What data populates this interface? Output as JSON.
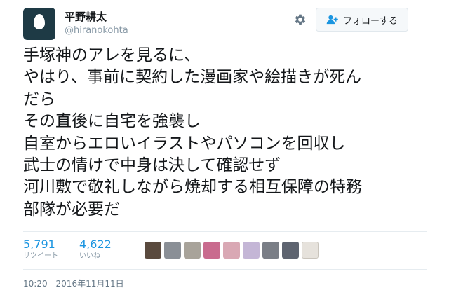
{
  "user": {
    "display_name": "平野耕太",
    "handle": "@hiranokohta",
    "avatar_icon": "default-egg-avatar"
  },
  "actions": {
    "settings_icon": "gear-icon",
    "follow_icon": "add-user-icon",
    "follow_label": "フォローする"
  },
  "tweet": {
    "lines": [
      "手塚神のアレを見るに、",
      "やはり、事前に契約した漫画家や絵描きが死ん",
      "だら",
      "その直後に自宅を強襲し",
      "自室からエロいイラストやパソコンを回収し",
      "武士の情けで中身は決して確認せず",
      "河川敷で敬礼しながら焼却する相互保障の特務",
      "部隊が必要だ"
    ]
  },
  "stats": {
    "retweets": {
      "count": "5,791",
      "label": "リツイート"
    },
    "likes": {
      "count": "4,622",
      "label": "いいね"
    }
  },
  "likers_count_shown": 9,
  "timestamp": "10:20 - 2016年11月11日",
  "colors": {
    "accent": "#1b95e0",
    "secondary_text": "#8899a6",
    "avatar_bg": "#1e3a45"
  }
}
